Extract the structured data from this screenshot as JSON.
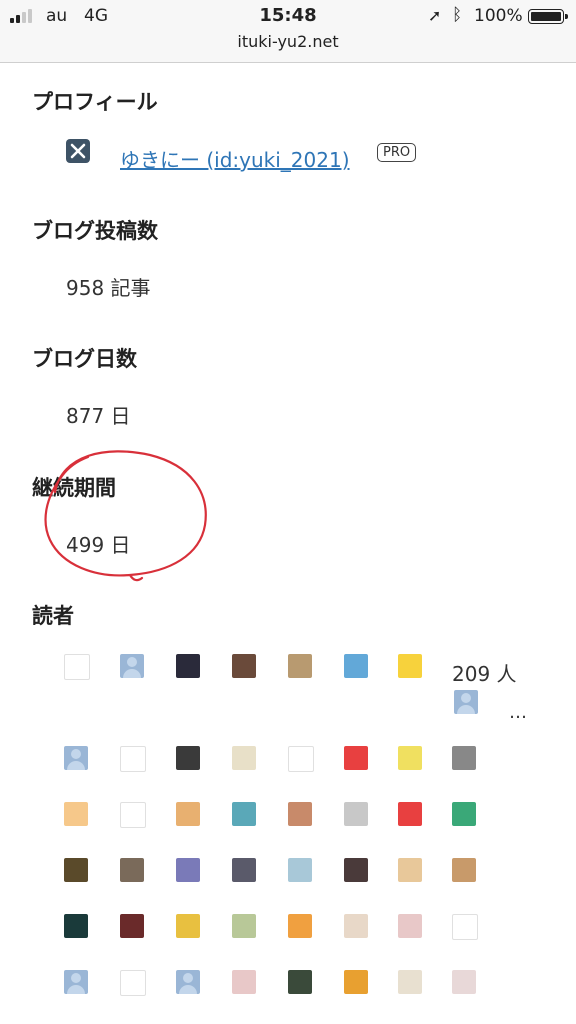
{
  "status_bar": {
    "carrier": "au",
    "network": "4G",
    "time": "15:48",
    "battery": "100%",
    "url": "ituki-yu2.net"
  },
  "profile": {
    "heading": "プロフィール",
    "link_text": "ゆきにー (id:yuki_2021)",
    "badge": "PRO"
  },
  "posts": {
    "heading": "ブログ投稿数",
    "value": "958 記事"
  },
  "days": {
    "heading": "ブログ日数",
    "value": "877 日"
  },
  "streak": {
    "heading": "継続期間",
    "value": "499 日"
  },
  "readers": {
    "heading": "読者",
    "count": "209 人",
    "more": "…",
    "avatar_colors": [
      "#ffffff",
      "#9ab6d6",
      "#2a2a3a",
      "#6a4a3a",
      "#b89a70",
      "#62a8d8",
      "#f7d23c",
      "#9ab6d6",
      "#9ab6d6",
      "#ffffff",
      "#3a3a3a",
      "#e8e0c8",
      "#ffffff",
      "#e84040",
      "#f0e060",
      "#888888",
      "#f6c88a",
      "#ffffff",
      "#e8b070",
      "#5aa8b8",
      "#c88a6a",
      "#c8c8c8",
      "#e84040",
      "#3aa878",
      "#5a4a2a",
      "#7a6a5a",
      "#7a7ab8",
      "#5a5a6a",
      "#a8c8d8",
      "#4a3a3a",
      "#e8c89a",
      "#c89a6a",
      "#1a3a3a",
      "#6a2a2a",
      "#e8c040",
      "#b8c898",
      "#f0a040",
      "#e8d8c8",
      "#e8c8c8",
      "#ffffff",
      "#9ab6d6",
      "#ffffff",
      "#9ab6d6",
      "#e8c8c8",
      "#3a4a3a",
      "#e8a030",
      "#e8e0d0",
      "#e8d8d8"
    ]
  }
}
